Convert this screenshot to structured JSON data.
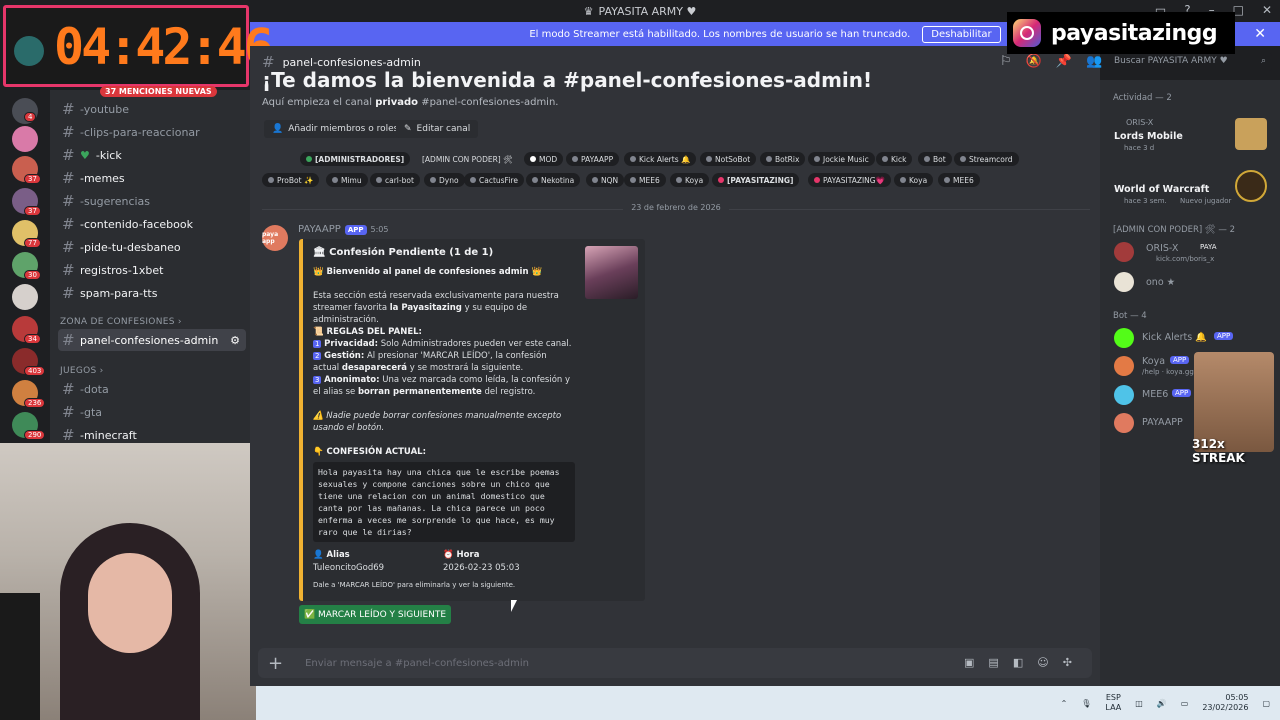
{
  "window": {
    "title": "PAYASITA ARMY ♥"
  },
  "streamer_bar": {
    "message": "El modo Streamer está habilitado. Los nombres de usuario se han truncado.",
    "button": "Deshabilitar"
  },
  "overlay": {
    "timer": "04:42:46",
    "instagram_handle": "payasitazingg",
    "streak": "312x STREAK"
  },
  "rail": {
    "badges": [
      "230",
      "4",
      "37",
      "37",
      "77",
      "30",
      "34",
      "403",
      "236",
      "290"
    ]
  },
  "channels": {
    "mentions_badge": "37 MENCIONES NUEVAS",
    "items": [
      {
        "label": "-youtube"
      },
      {
        "label": "-clips-para-reaccionar"
      },
      {
        "label": "-kick"
      },
      {
        "label": "-memes"
      },
      {
        "label": "-sugerencias"
      },
      {
        "label": "-contenido-facebook"
      },
      {
        "label": "-pide-tu-desbaneo"
      },
      {
        "label": "registros-1xbet"
      },
      {
        "label": "spam-para-tts"
      }
    ],
    "category_confesiones": "ZONA DE CONFESIONES",
    "active_channel": "panel-confesiones-admin",
    "category_juegos": "JUEGOS",
    "game_items": [
      {
        "label": "-dota"
      },
      {
        "label": "-gta"
      },
      {
        "label": "-minecraft"
      }
    ]
  },
  "header": {
    "channel": "panel-confesiones-admin",
    "search_placeholder": "Buscar PAYASITA ARMY ♥"
  },
  "welcome": {
    "title": "¡Te damos la bienvenida a #panel-confesiones-admin!",
    "subtitle_pre": "Aquí empieza el canal ",
    "subtitle_bold": "privado",
    "subtitle_post": " #panel-confesiones-admin.",
    "add_members": "Añadir miembros o roles",
    "edit_channel": "Editar canal"
  },
  "roles": {
    "row1": [
      "[ADMINISTRADORES]",
      "[ADMIN CON PODER] 🛠",
      "MOD",
      "PAYAAPP",
      "Kick Alerts 🔔",
      "NotSoBot",
      "BotRix",
      "Jockie Music",
      "Kick",
      "Bot",
      "Streamcord"
    ],
    "row2": [
      "ProBot ✨",
      "Mimu",
      "carl-bot",
      "Dyno",
      "CactusFire",
      "Nekotina",
      "NQN",
      "MEE6",
      "Koya",
      "[PAYASITAZING]",
      "PAYASITAZING💗",
      "Koya",
      "MEE6"
    ]
  },
  "date_separator": "23 de febrero de 2026",
  "message": {
    "author": "PAYAAPP",
    "app_tag": "APP",
    "time": "5:05",
    "avatar_text": "paya app",
    "embed": {
      "title": "🏛 Confesión Pendiente (1 de 1)",
      "welcome": "👑 Bienvenido al panel de confesiones admin 👑",
      "intro_pre": "Esta sección está reservada exclusivamente para nuestra streamer favorita ",
      "intro_bold": "la Payasitazing",
      "intro_post": " y su equipo de administración.",
      "rules_title": "📜 REGLAS DEL PANEL:",
      "rule1_num": "1",
      "rule1_bold": "Privacidad:",
      "rule1_text": " Solo Administradores pueden ver este canal.",
      "rule2_num": "2",
      "rule2_bold": "Gestión:",
      "rule2_text": " Al presionar 'MARCAR LEÍDO', la confesión actual ",
      "rule2_bold2": "desaparecerá",
      "rule2_text2": " y se mostrará la siguiente.",
      "rule3_num": "3",
      "rule3_bold": "Anonimato:",
      "rule3_text": " Una vez marcada como leída, la confesión y el alias se ",
      "rule3_bold2": "borran permanentemente",
      "rule3_text2": " del registro.",
      "warning": "⚠️ Nadie puede borrar confesiones manualmente excepto usando el botón.",
      "current_title": "👇 CONFESIÓN ACTUAL:",
      "confession": "Hola payasita hay una chica que le escribe poemas sexuales y compone canciones sobre un chico que tiene una relacion con un animal domestico que canta por las mañanas. La chica parece un poco enferma a veces me sorprende lo que hace, es muy raro que le dirias?",
      "alias_label": "👤 Alias",
      "alias_value": "TuleoncitoGod69",
      "hora_label": "⏰ Hora",
      "hora_value": "2026-02-23 05:03",
      "footer": "Dale a 'MARCAR LEÍDO' para eliminarla y ver la siguiente."
    },
    "button": "✅ MARCAR LEÍDO Y SIGUIENTE"
  },
  "composer": {
    "placeholder": "Enviar mensaje a #panel-confesiones-admin"
  },
  "members": {
    "activity_header": "Actividad — 2",
    "act1_user": "ORIS-X",
    "act1_game": "Lords Mobile",
    "act1_time": "hace 3 d",
    "act2_game": "World of Warcraft",
    "act2_time": "hace 3 sem.",
    "act2_extra": "Nuevo jugador",
    "admin_header": "[ADMIN CON PODER] 🛠 — 2",
    "admin1_name": "ORIS-X",
    "admin1_tag": "PAYA",
    "admin1_sub": "kick.com/boris_x",
    "admin2_name": "ono ★",
    "bot_header": "Bot — 4",
    "bot1": "Kick Alerts 🔔",
    "bot1_tag": "APP",
    "bot2": "Koya",
    "bot2_tag": "APP",
    "bot2_sub": "/help · koya.gg",
    "bot3": "MEE6",
    "bot3_tag": "APP",
    "bot4": "PAYAAPP"
  },
  "taskbar": {
    "lang1": "ESP",
    "lang2": "LAA",
    "time": "05:05",
    "date": "23/02/2026"
  }
}
